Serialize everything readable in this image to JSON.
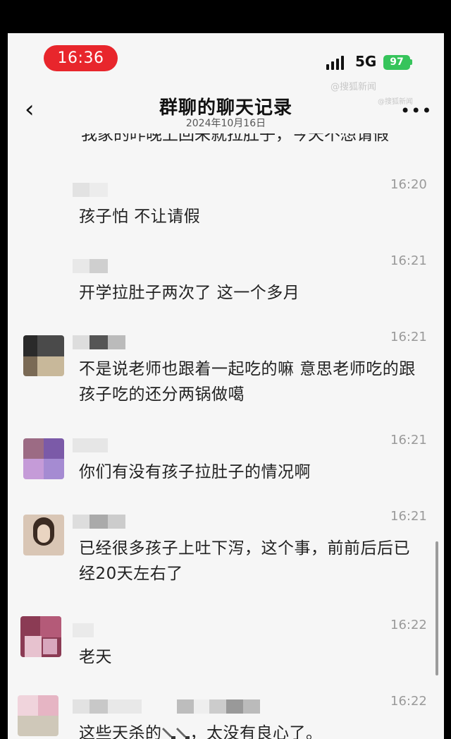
{
  "status": {
    "time": "16:36",
    "network": "5G",
    "battery": "97"
  },
  "watermark": {
    "line1": "@搜狐新闻",
    "line2": "@搜狐新闻"
  },
  "header": {
    "back_icon": "chevron-left-icon",
    "title": "群聊的聊天记录",
    "subtitle": "2024年10月16日",
    "more_icon": "more-dots-icon",
    "back_glyph": "‹",
    "more_glyph": "•••"
  },
  "chat": {
    "cut_message": "我家的昨晚上回来就拉肚子，今天不想请假",
    "messages": [
      {
        "time": "16:20",
        "text": "孩子怕  不让请假"
      },
      {
        "time": "16:21",
        "text": "开学拉肚子两次了    这一个多月"
      },
      {
        "time": "16:21",
        "text": "不是说老师也跟着一起吃的嘛  意思老师吃的跟孩子吃的还分两锅做噶"
      },
      {
        "time": "16:21",
        "text": "你们有没有孩子拉肚子的情况啊"
      },
      {
        "time": "16:21",
        "text": "已经很多孩子上吐下泻，这个事，前前后后已经20天左右了"
      },
      {
        "time": "16:22",
        "text": "老天"
      },
      {
        "time": "16:22",
        "text_before": "这些天杀的",
        "text_after": "，太没有良心了。",
        "emoji": "knife-icon"
      }
    ]
  }
}
